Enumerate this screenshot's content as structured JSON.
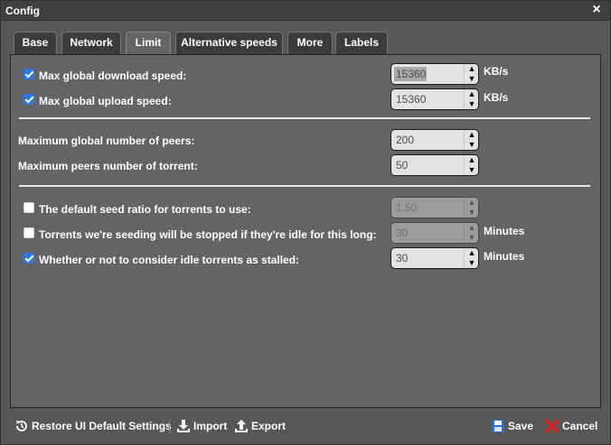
{
  "window": {
    "title": "Config",
    "close_glyph": "×"
  },
  "tabs": [
    {
      "label": "Base"
    },
    {
      "label": "Network"
    },
    {
      "label": "Limit",
      "active": true
    },
    {
      "label": "Alternative speeds"
    },
    {
      "label": "More"
    },
    {
      "label": "Labels"
    }
  ],
  "limit": {
    "speed": [
      {
        "label": "Max global download speed:",
        "checked": true,
        "value": "15360",
        "unit": "KB/s"
      },
      {
        "label": "Max global upload speed:",
        "checked": true,
        "value": "15360",
        "unit": "KB/s"
      }
    ],
    "peers": [
      {
        "label": "Maximum global number of peers:",
        "value": "200"
      },
      {
        "label": "Maximum peers number of torrent:",
        "value": "50"
      }
    ],
    "seeding": [
      {
        "label": "The default seed ratio for torrents to use:",
        "checked": false,
        "value": "1.50",
        "unit": "",
        "disabled": true
      },
      {
        "label": "Torrents we're seeding will be stopped if they're idle for this long:",
        "checked": false,
        "value": "30",
        "unit": "Minutes",
        "disabled": true
      },
      {
        "label": "Whether or not to consider idle torrents as stalled:",
        "checked": true,
        "value": "30",
        "unit": "Minutes",
        "disabled": false
      }
    ]
  },
  "footer": {
    "restore_label": "Restore UI Default Settings",
    "import_label": "Import",
    "export_label": "Export",
    "save_label": "Save",
    "cancel_label": "Cancel"
  },
  "icons": {
    "restore": "restore-icon",
    "import": "download-icon",
    "export": "upload-icon",
    "save": "floppy-disk-icon",
    "cancel": "red-x-icon"
  },
  "colors": {
    "checkbox_checked": "#2b78e4",
    "save_icon": "#2a6fc9",
    "cancel_icon": "#e02020"
  }
}
